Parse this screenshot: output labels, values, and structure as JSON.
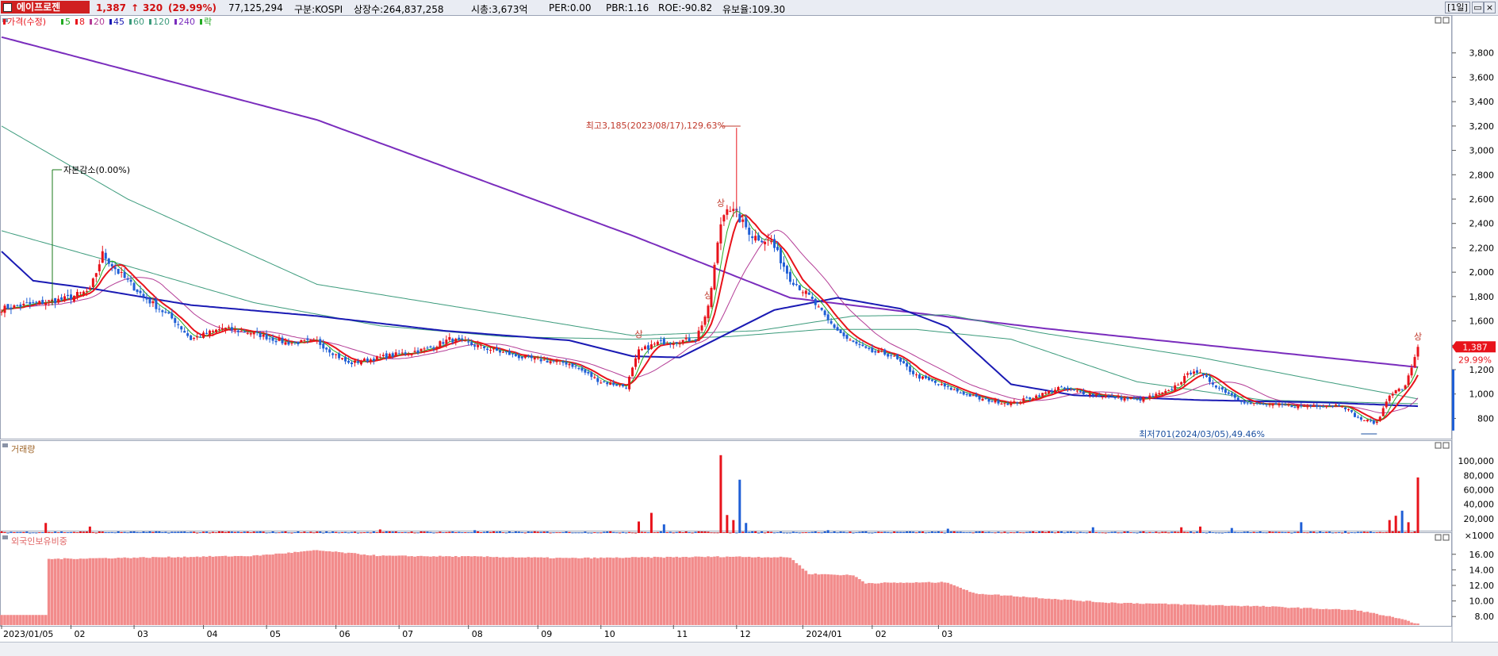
{
  "header": {
    "stock_name": "에이프로젠",
    "price": "1,387",
    "change": "320",
    "change_pct": "(29.99%)",
    "volume": "77,125,294",
    "market": "구분:KOSPI",
    "shares": "상장수:264,837,258",
    "mcap": "시총:3,673억",
    "per": "PER:0.00",
    "pbr": "PBR:1.16",
    "roe": "ROE:-90.82",
    "retention": "유보율:109.30",
    "period_button": "[1일]",
    "arrow": "↑"
  },
  "colors": {
    "up": "#e8131b",
    "down": "#1f5fd6",
    "ma5": "#22aa22",
    "ma8": "#e8131b",
    "ma20": "#b43c96",
    "ma45": "#1a1ab4",
    "ma60": "#3c9b7c",
    "ma120": "#3c9b7c",
    "ma240": "#7a2dbd",
    "foreign": "#f28b8b"
  },
  "chart_data": [
    {
      "type": "candlestick",
      "title": "",
      "legend": [
        {
          "label": "가격(수정)",
          "color": "#e8131b"
        },
        {
          "label": "5",
          "color": "#22aa22"
        },
        {
          "label": "8",
          "color": "#e8131b"
        },
        {
          "label": "20",
          "color": "#b43c96"
        },
        {
          "label": "45",
          "color": "#1a1ab4"
        },
        {
          "label": "60",
          "color": "#3c9b7c"
        },
        {
          "label": "120",
          "color": "#3c9b7c"
        },
        {
          "label": "240",
          "color": "#7a2dbd"
        },
        {
          "label": "락",
          "color": "#22aa22"
        }
      ],
      "y_ticks": [
        "800",
        "1,000",
        "1,200",
        "1,400",
        "1,600",
        "1,800",
        "2,000",
        "2,200",
        "2,400",
        "2,600",
        "2,800",
        "3,000",
        "3,200",
        "3,400",
        "3,600",
        "3,800"
      ],
      "ylim": [
        640,
        4000
      ],
      "x_ticks": [
        "2023/01/05",
        "02",
        "03",
        "04",
        "05",
        "06",
        "07",
        "08",
        "09",
        "10",
        "11",
        "12",
        "2024/01",
        "02",
        "03"
      ],
      "close_anchors": [
        [
          0,
          1700
        ],
        [
          20,
          1780
        ],
        [
          28,
          1850
        ],
        [
          32,
          2150
        ],
        [
          37,
          2000
        ],
        [
          45,
          1800
        ],
        [
          55,
          1600
        ],
        [
          60,
          1450
        ],
        [
          70,
          1540
        ],
        [
          80,
          1500
        ],
        [
          90,
          1420
        ],
        [
          100,
          1430
        ],
        [
          110,
          1250
        ],
        [
          120,
          1300
        ],
        [
          135,
          1370
        ],
        [
          142,
          1450
        ],
        [
          150,
          1400
        ],
        [
          165,
          1300
        ],
        [
          180,
          1250
        ],
        [
          190,
          1100
        ],
        [
          198,
          1060
        ],
        [
          202,
          1350
        ],
        [
          208,
          1420
        ],
        [
          220,
          1450
        ],
        [
          224,
          1700
        ],
        [
          228,
          2400
        ],
        [
          230,
          2550
        ],
        [
          233,
          2470
        ],
        [
          238,
          2300
        ],
        [
          244,
          2250
        ],
        [
          250,
          1950
        ],
        [
          256,
          1800
        ],
        [
          262,
          1600
        ],
        [
          268,
          1450
        ],
        [
          275,
          1350
        ],
        [
          282,
          1320
        ],
        [
          290,
          1150
        ],
        [
          300,
          1050
        ],
        [
          310,
          960
        ],
        [
          320,
          920
        ],
        [
          330,
          1000
        ],
        [
          335,
          1050
        ],
        [
          345,
          1000
        ],
        [
          360,
          950
        ],
        [
          370,
          1020
        ],
        [
          378,
          1200
        ],
        [
          386,
          1050
        ],
        [
          395,
          920
        ],
        [
          410,
          900
        ],
        [
          425,
          910
        ],
        [
          430,
          800
        ],
        [
          436,
          760
        ],
        [
          440,
          1000
        ],
        [
          445,
          1060
        ],
        [
          449,
          1387
        ]
      ],
      "ma240_anchors": [
        [
          0,
          3930
        ],
        [
          100,
          3250
        ],
        [
          200,
          2300
        ],
        [
          250,
          1790
        ],
        [
          330,
          1540
        ],
        [
          449,
          1220
        ]
      ],
      "ma120_anchors": [
        [
          0,
          3200
        ],
        [
          40,
          2600
        ],
        [
          100,
          1900
        ],
        [
          160,
          1650
        ],
        [
          200,
          1480
        ],
        [
          240,
          1520
        ],
        [
          270,
          1640
        ],
        [
          300,
          1650
        ],
        [
          330,
          1500
        ],
        [
          380,
          1300
        ],
        [
          420,
          1100
        ],
        [
          449,
          960
        ]
      ],
      "ma60_anchors": [
        [
          0,
          2340
        ],
        [
          40,
          2050
        ],
        [
          80,
          1750
        ],
        [
          120,
          1560
        ],
        [
          160,
          1470
        ],
        [
          200,
          1450
        ],
        [
          230,
          1470
        ],
        [
          260,
          1530
        ],
        [
          290,
          1530
        ],
        [
          320,
          1450
        ],
        [
          360,
          1100
        ],
        [
          400,
          950
        ],
        [
          449,
          920
        ]
      ],
      "ma45_anchors": [
        [
          0,
          2170
        ],
        [
          10,
          1930
        ],
        [
          30,
          1860
        ],
        [
          60,
          1730
        ],
        [
          100,
          1640
        ],
        [
          140,
          1520
        ],
        [
          180,
          1440
        ],
        [
          200,
          1310
        ],
        [
          215,
          1300
        ],
        [
          225,
          1430
        ],
        [
          245,
          1690
        ],
        [
          265,
          1790
        ],
        [
          285,
          1700
        ],
        [
          300,
          1550
        ],
        [
          320,
          1080
        ],
        [
          340,
          990
        ],
        [
          380,
          950
        ],
        [
          420,
          930
        ],
        [
          449,
          900
        ]
      ],
      "marks": [
        {
          "text": "최고3,185(2023/08/17),129.63%",
          "color": "#c0392b"
        },
        {
          "text": "최저701(2024/03/05),49.46%",
          "color": "#1a4fa0"
        },
        {
          "text": "자본감소(0.00%)",
          "color": "#000"
        },
        {
          "text": "상",
          "color": "#c0392b"
        }
      ],
      "price_tag": "1,387",
      "pct_tag": "29.99%"
    },
    {
      "type": "bar",
      "title": "거래량",
      "y_ticks": [
        "×1000",
        "20,000",
        "40,000",
        "60,000",
        "80,000",
        "100,000"
      ],
      "ylim": [
        0,
        110000
      ],
      "spikes": [
        [
          14,
          14000
        ],
        [
          28,
          9000
        ],
        [
          120,
          5000
        ],
        [
          150,
          4000
        ],
        [
          202,
          16000
        ],
        [
          206,
          28000
        ],
        [
          210,
          12000
        ],
        [
          228,
          108000
        ],
        [
          230,
          25000
        ],
        [
          232,
          18000
        ],
        [
          234,
          74000
        ],
        [
          236,
          14000
        ],
        [
          262,
          4000
        ],
        [
          300,
          6000
        ],
        [
          346,
          8000
        ],
        [
          374,
          8000
        ],
        [
          380,
          9000
        ],
        [
          390,
          7000
        ],
        [
          412,
          15000
        ],
        [
          426,
          3000
        ],
        [
          440,
          18000
        ],
        [
          442,
          24000
        ],
        [
          444,
          31000
        ],
        [
          446,
          15000
        ],
        [
          449,
          77125
        ]
      ]
    },
    {
      "type": "bar",
      "title": "외국인보유비중",
      "y_ticks": [
        "8.00",
        "10.00",
        "12.00",
        "14.00",
        "16.00"
      ],
      "ylim": [
        6.9,
        17.2
      ],
      "anchors": [
        [
          0,
          8.2
        ],
        [
          14,
          8.2
        ],
        [
          15,
          15.4
        ],
        [
          80,
          15.8
        ],
        [
          100,
          16.5
        ],
        [
          120,
          15.8
        ],
        [
          150,
          15.7
        ],
        [
          180,
          15.5
        ],
        [
          230,
          15.7
        ],
        [
          250,
          15.6
        ],
        [
          256,
          13.5
        ],
        [
          270,
          13.3
        ],
        [
          274,
          12.3
        ],
        [
          300,
          12.4
        ],
        [
          308,
          11.0
        ],
        [
          350,
          9.8
        ],
        [
          400,
          9.3
        ],
        [
          430,
          8.8
        ],
        [
          440,
          8.0
        ],
        [
          449,
          7.1
        ]
      ]
    }
  ]
}
